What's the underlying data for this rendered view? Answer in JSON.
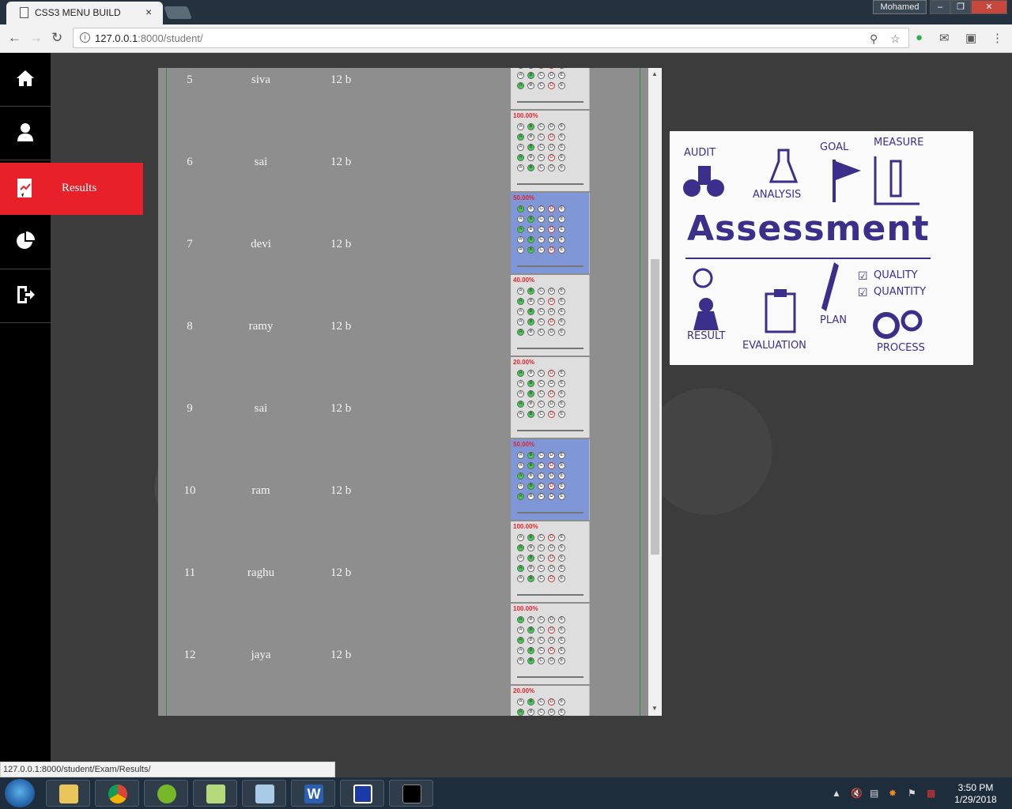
{
  "browser": {
    "tab_title": "CSS3 MENU BUILD",
    "tab_close": "×",
    "user_name": "Mohamed",
    "url_host": "127.0.0.1",
    "url_rest": ":8000/student/"
  },
  "sidebar": {
    "items": [
      {
        "name": "home",
        "icon": "home-icon"
      },
      {
        "name": "profile",
        "icon": "user-icon"
      },
      {
        "name": "results",
        "icon": "results-icon",
        "label": "Results",
        "active": true
      },
      {
        "name": "reports",
        "icon": "pie-chart-icon"
      },
      {
        "name": "logout",
        "icon": "logout-icon"
      }
    ],
    "active_color": "#e8202a"
  },
  "results": {
    "rows": [
      {
        "id": "5",
        "name": "siva",
        "class": "12 b",
        "score": "",
        "sheet": "gray"
      },
      {
        "id": "6",
        "name": "sai",
        "class": "12 b",
        "score": "100.00%",
        "sheet": "gray"
      },
      {
        "id": "7",
        "name": "devi",
        "class": "12 b",
        "score": "50.00%",
        "sheet": "blue"
      },
      {
        "id": "8",
        "name": "ramy",
        "class": "12 b",
        "score": "40.00%",
        "sheet": "gray"
      },
      {
        "id": "9",
        "name": "sai",
        "class": "12 b",
        "score": "20.00%",
        "sheet": "gray"
      },
      {
        "id": "10",
        "name": "ram",
        "class": "12 b",
        "score": "50.00%",
        "sheet": "blue"
      },
      {
        "id": "11",
        "name": "raghu",
        "class": "12 b",
        "score": "100.00%",
        "sheet": "gray"
      },
      {
        "id": "12",
        "name": "jaya",
        "class": "12 b",
        "score": "100.00%",
        "sheet": "gray"
      },
      {
        "id": "",
        "name": "",
        "class": "",
        "score": "20.00%",
        "sheet": "gray"
      }
    ]
  },
  "assessment_image": {
    "title": "Assessment",
    "words": [
      "AUDIT",
      "ANALYSIS",
      "GOAL",
      "MEASURE",
      "QUALITY",
      "QUANTITY",
      "RESULT",
      "EVALUATION",
      "PLAN",
      "PROCESS"
    ]
  },
  "status_bar": {
    "url": "127.0.0.1:8000/student/Exam/Results/"
  },
  "taskbar": {
    "time": "3:50 PM",
    "date": "1/29/2018"
  }
}
